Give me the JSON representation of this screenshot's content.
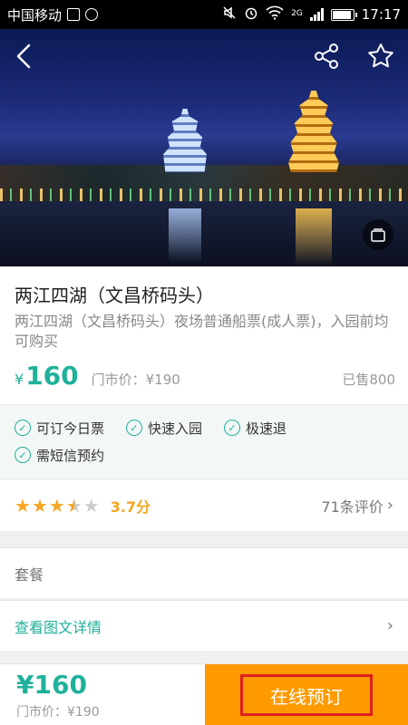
{
  "status_bar": {
    "carrier": "中国移动",
    "network": "2G",
    "time": "17:17"
  },
  "hero": {
    "back_icon": "chevron-left-icon",
    "share_icon": "share-icon",
    "favorite_icon": "star-outline-icon",
    "gallery_icon": "gallery-icon"
  },
  "product": {
    "title": "两江四湖（文昌桥码头）",
    "subtitle": "两江四湖（文昌桥码头）夜场普通船票(成人票)，入园前均可购买",
    "currency_symbol": "¥",
    "price": "160",
    "list_price": "门市价：¥190",
    "sold": "已售800"
  },
  "features": [
    "可订今日票",
    "快速入园",
    "极速退",
    "需短信预约"
  ],
  "rating": {
    "stars": 3.7,
    "score": "3.7分",
    "reviews": "71条评价"
  },
  "package": {
    "label": "套餐"
  },
  "details": {
    "label": "查看图文详情"
  },
  "bottom_bar": {
    "price": "¥160",
    "list_price": "门市价：¥190",
    "book_label": "在线预订"
  },
  "colors": {
    "accent": "#1fb19a",
    "book_button": "#ff9a00",
    "highlight_border": "#e02020",
    "star": "#f5a623"
  }
}
